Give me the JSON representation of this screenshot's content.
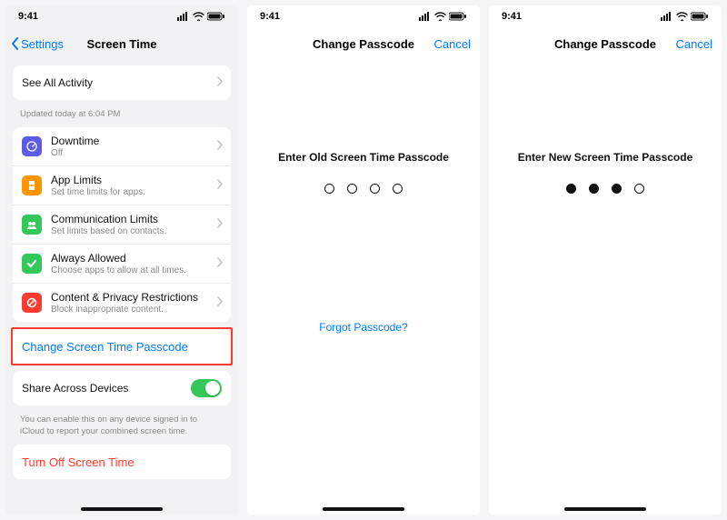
{
  "status": {
    "time": "9:41"
  },
  "screen1": {
    "back": "Settings",
    "title": "Screen Time",
    "seeAll": "See All Activity",
    "updated": "Updated today at 6:04 PM",
    "items": [
      {
        "title": "Downtime",
        "sub": "Off",
        "color": "#5e5ce6"
      },
      {
        "title": "App Limits",
        "sub": "Set time limits for apps.",
        "color": "#ff9500"
      },
      {
        "title": "Communication Limits",
        "sub": "Set limits based on contacts.",
        "color": "#34c759"
      },
      {
        "title": "Always Allowed",
        "sub": "Choose apps to allow at all times.",
        "color": "#34c759"
      },
      {
        "title": "Content & Privacy Restrictions",
        "sub": "Block inappropriate content.",
        "color": "#ff3b30"
      }
    ],
    "changePasscode": "Change Screen Time Passcode",
    "share": "Share Across Devices",
    "shareFooter": "You can enable this on any device signed in to iCloud to report your combined screen time.",
    "turnOff": "Turn Off Screen Time"
  },
  "screen2": {
    "title": "Change Passcode",
    "cancel": "Cancel",
    "prompt": "Enter Old Screen Time Passcode",
    "filled": 0,
    "forgot": "Forgot Passcode?"
  },
  "screen3": {
    "title": "Change Passcode",
    "cancel": "Cancel",
    "prompt": "Enter New Screen Time Passcode",
    "filled": 3
  }
}
